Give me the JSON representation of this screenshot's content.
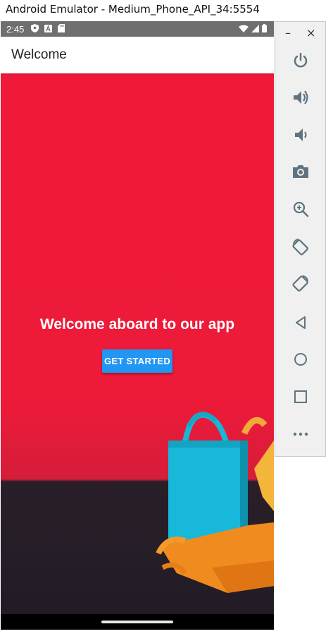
{
  "window": {
    "title": "Android Emulator - Medium_Phone_API_34:5554"
  },
  "statusbar": {
    "time": "2:45"
  },
  "appbar": {
    "title": "Welcome"
  },
  "hero": {
    "heading": "Welcome aboard to our app",
    "button_label": "GET STARTED"
  },
  "toolbar": {
    "minimize": "–",
    "close": "×",
    "buttons": [
      {
        "icon": "power-icon"
      },
      {
        "icon": "volume-up-icon"
      },
      {
        "icon": "volume-down-icon"
      },
      {
        "icon": "camera-icon"
      },
      {
        "icon": "zoom-icon"
      },
      {
        "icon": "rotate-left-icon"
      },
      {
        "icon": "rotate-right-icon"
      },
      {
        "icon": "back-icon"
      },
      {
        "icon": "home-icon"
      },
      {
        "icon": "overview-icon"
      },
      {
        "icon": "more-icon"
      }
    ]
  },
  "colors": {
    "accent": "#2196f3",
    "hero_red": "#f0193a",
    "statusbar": "#6f6f6f",
    "toolbar_icon": "#5f7480"
  }
}
